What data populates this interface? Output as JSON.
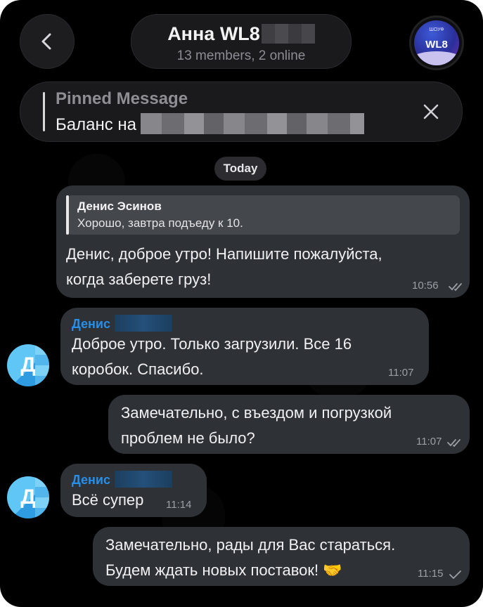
{
  "header": {
    "back_icon": "chevron-left-icon",
    "chat_title": "Анна WL8",
    "chat_subtitle": "13 members, 2 online",
    "avatar_small_text": "ШОУФ",
    "avatar_text": "WL8"
  },
  "pinned": {
    "title": "Pinned Message",
    "text": "Баланс на",
    "close_icon": "close-icon"
  },
  "date_separator": "Today",
  "messages": [
    {
      "reply_name": "Денис Эсинов",
      "reply_text": "Хорошо, завтра подъеду к 10.",
      "text": "Денис, доброе утро! Напишите пожалуйста,\nкогда заберете груз!",
      "time": "10:56"
    },
    {
      "sender": "Денис",
      "text": "Доброе утро. Только загрузили. Все 16\nкоробок. Спасибо.",
      "time": "11:07",
      "avatar_letter": "Д"
    },
    {
      "text": "Замечательно, с въездом и погрузкой\nпроблем не было?",
      "time": "11:07"
    },
    {
      "sender": "Денис",
      "text": "Всё супер",
      "time": "11:14",
      "avatar_letter": "Д"
    },
    {
      "text": "Замечательно, рады для Вас стараться.\nБудем ждать новых поставок! 🤝",
      "time": "11:15"
    }
  ],
  "colors": {
    "background": "#000000",
    "bubble": "#2e3136",
    "sender_name": "#2a8ee6"
  }
}
